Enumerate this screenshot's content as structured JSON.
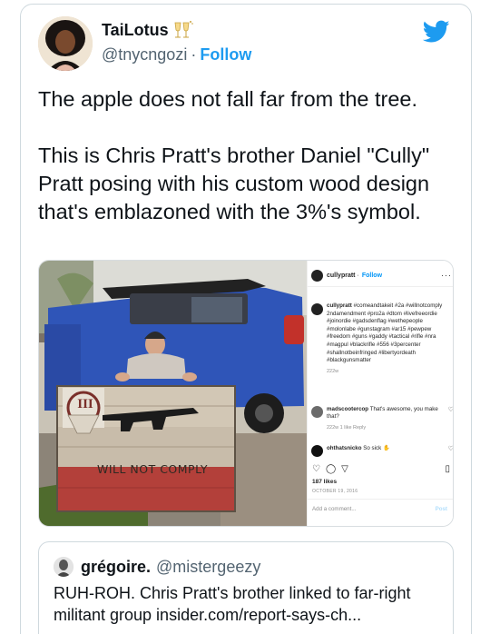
{
  "tweet": {
    "author_name": "TaiLotus",
    "name_emoji": "champagne-glasses-icon",
    "author_handle": "@tnycngozi",
    "separator": "·",
    "follow_label": "Follow",
    "platform_icon": "twitter-bird-icon",
    "text_paragraphs": [
      "The apple does not fall far from the tree.",
      "This is Chris Pratt's brother Daniel \"Cully\" Pratt posing with his custom wood design that's emblazoned with the 3%'s symbol."
    ]
  },
  "media": {
    "sign_text": "WILL NOT COMPLY",
    "sign_numeral": "III",
    "instagram": {
      "username": "cullypratt",
      "follow_label": "Follow",
      "more_label": "···",
      "caption_user": "cullypratt",
      "caption_text": "#comeandtakeit #2a #willnotcomply 2ndamendment #pro2a #dtom #livefreeordie #joinordie #gadsdenflag #wethepeople #molonlabe #gunstagram #ar15 #pewpew #freedom #guns #gaddy #tactical #rifle #nra #magpul #blackrifle #556 #3percenter #shallnotbeinfringed #libertyordeath #blackgunsmatter",
      "caption_age": "222w",
      "comments": [
        {
          "user": "madscootercop",
          "text": "That's awesome, you make that?",
          "meta": "222w  1 like  Reply"
        },
        {
          "user": "ohthatsnicko",
          "text": "So sick",
          "meta": ""
        }
      ],
      "likes": "187 likes",
      "date": "OCTOBER 19, 2016",
      "add_comment_placeholder": "Add a comment...",
      "post_label": "Post"
    }
  },
  "quote": {
    "name": "grégoire.",
    "handle": "@mistergeezy",
    "text": "RUH-ROH. Chris Pratt's brother linked to far-right militant group insider.com/report-says-ch..."
  },
  "colors": {
    "link_blue": "#1d9bf0",
    "secondary_text": "#536471",
    "border": "#cfd9de"
  }
}
